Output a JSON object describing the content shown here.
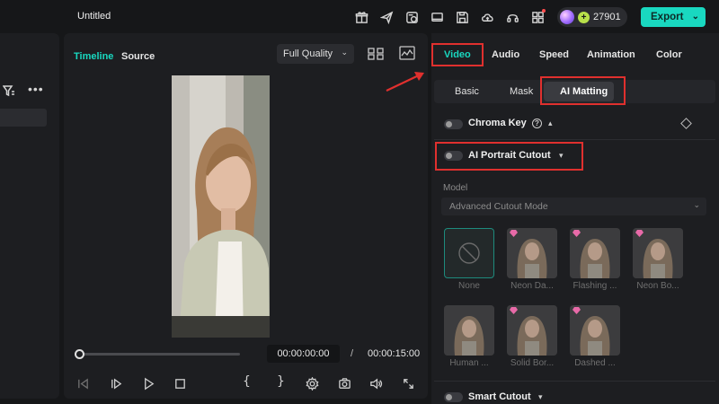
{
  "app": {
    "title": "Untitled"
  },
  "topbar": {
    "credits": "27901",
    "export_label": "Export",
    "icons": [
      "gift-icon",
      "send-icon",
      "history-icon",
      "screen-icon",
      "save-icon",
      "cloud-upload-icon",
      "headset-icon",
      "apps-icon"
    ]
  },
  "preview_panel": {
    "tabs": [
      "Timeline",
      "Source"
    ],
    "quality": "Full Quality",
    "time_current": "00:00:00:00",
    "time_separator": "/",
    "time_total": "00:00:15:00",
    "playback_progress": 0
  },
  "inspector": {
    "tabs": [
      "Video",
      "Audio",
      "Speed",
      "Animation",
      "Color"
    ],
    "active_tab": "Video",
    "subtabs": [
      "Basic",
      "Mask",
      "AI Matting"
    ],
    "active_subtab": "AI Matting",
    "chroma_key": "Chroma Key",
    "ai_portrait": "AI Portrait Cutout",
    "model_label": "Model",
    "model_value": "Advanced Cutout Mode",
    "presets": [
      "None",
      "Neon Da...",
      "Flashing ...",
      "Neon Bo...",
      "Human ...",
      "Solid Bor...",
      "Dashed ..."
    ],
    "smart_cutout": "Smart Cutout"
  },
  "colors": {
    "accent": "#19d8c0",
    "highlight": "#e0302e"
  }
}
